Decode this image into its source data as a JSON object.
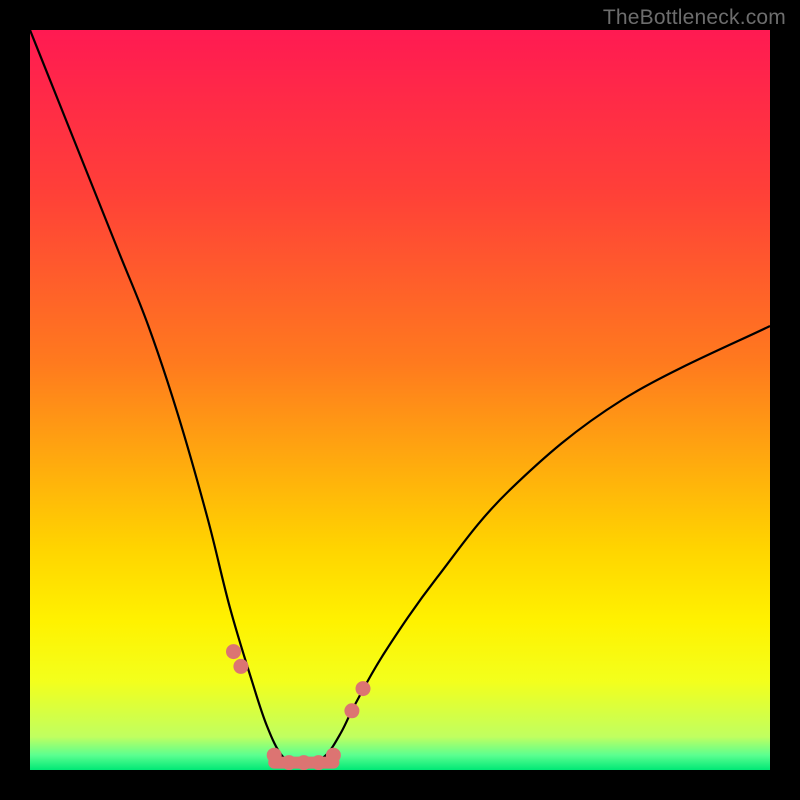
{
  "watermark": "TheBottleneck.com",
  "gradient_colors": {
    "c0": "#ff1a52",
    "c1": "#ff4038",
    "c2": "#ff7a1e",
    "c3": "#ffd400",
    "c4": "#fff200",
    "c5": "#f3ff1c",
    "c6": "#c0ff60",
    "c7": "#5bff90",
    "c8": "#00e876"
  },
  "chart_data": {
    "type": "line",
    "title": "",
    "xlabel": "",
    "ylabel": "",
    "xlim": [
      0,
      100
    ],
    "ylim": [
      0,
      100
    ],
    "description": "V-shaped bottleneck curve: steep descent from top-left, flat minimum around x≈33–41, then rises toward upper-right. Salmon markers near the minimum.",
    "series": [
      {
        "name": "bottleneck-curve",
        "x": [
          0,
          4,
          8,
          12,
          16,
          20,
          24,
          27,
          30,
          32,
          34,
          36,
          38,
          40,
          42,
          44,
          48,
          55,
          65,
          80,
          100
        ],
        "y": [
          100,
          90,
          80,
          70,
          60,
          48,
          34,
          22,
          12,
          6,
          2,
          1,
          1,
          2,
          5,
          9,
          16,
          26,
          38,
          50,
          60
        ]
      }
    ],
    "markers": {
      "name": "highlight-points",
      "x": [
        27.5,
        28.5,
        33,
        35,
        37,
        39,
        41,
        43.5,
        45
      ],
      "y": [
        16,
        14,
        2,
        1,
        1,
        1,
        2,
        8,
        11
      ]
    }
  }
}
